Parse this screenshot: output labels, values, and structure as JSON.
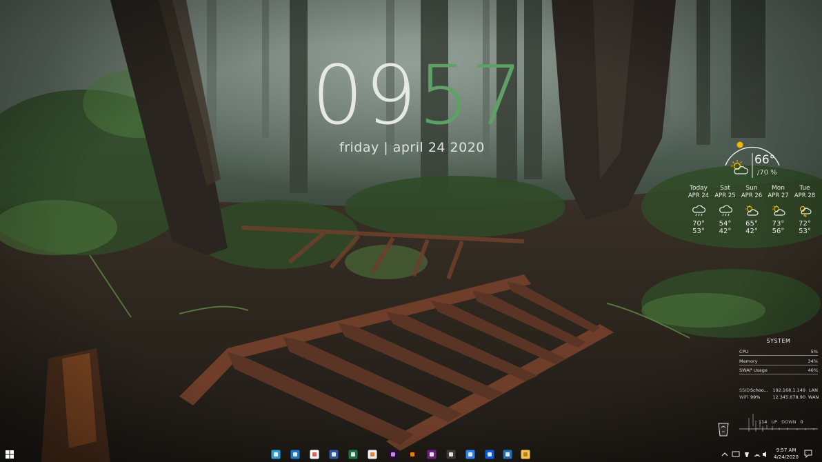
{
  "clock": {
    "hours": "09",
    "minutes": "57"
  },
  "date_text": "friday | april 24 2020",
  "weather": {
    "current_temp": "66°",
    "humidity": "70 %",
    "forecast": [
      {
        "day": "Today",
        "date": "APR 24",
        "icon": "rain-cloud-icon",
        "high": "70°",
        "low": "53°"
      },
      {
        "day": "Sat",
        "date": "APR 25",
        "icon": "rain-cloud-icon",
        "high": "54°",
        "low": "42°"
      },
      {
        "day": "Sun",
        "date": "APR 26",
        "icon": "partly-cloudy-icon",
        "high": "65°",
        "low": "42°"
      },
      {
        "day": "Mon",
        "date": "APR 27",
        "icon": "partly-cloudy-icon",
        "high": "73°",
        "low": "56°"
      },
      {
        "day": "Tue",
        "date": "APR 28",
        "icon": "thunderstorm-icon",
        "high": "72°",
        "low": "53°"
      }
    ]
  },
  "system": {
    "title": "SYSTEM",
    "rows": [
      {
        "label": "CPU",
        "value": "5%"
      },
      {
        "label": "Memory",
        "value": "34%"
      },
      {
        "label": "SWAP Usage",
        "value": "46%"
      }
    ],
    "network": [
      {
        "key": "SSID",
        "name": "Schoo...",
        "ip": "192.168.1.149",
        "type": "LAN"
      },
      {
        "key": "WiFi",
        "name": "99%",
        "ip": "12.345.678.90",
        "type": "WAN"
      }
    ],
    "speed": {
      "up_value": "114",
      "up_label": "UP",
      "down_label": "DOWN",
      "down_value": "0"
    }
  },
  "taskbar": {
    "apps": [
      "windows-start-icon",
      "file-explorer-icon",
      "store-icon",
      "chrome-icon",
      "word-icon",
      "excel-icon",
      "illustration-app-icon",
      "premiere-icon",
      "illustrator-icon",
      "visual-studio-icon",
      "calculator-icon",
      "todo-icon",
      "bluetooth-icon",
      "remote-desktop-icon",
      "folder-icon"
    ],
    "tray_time": "9:57 AM",
    "tray_date": "4/24/2020"
  },
  "colors": {
    "accent_green": "#5fa066",
    "sun": "#f4b400"
  }
}
